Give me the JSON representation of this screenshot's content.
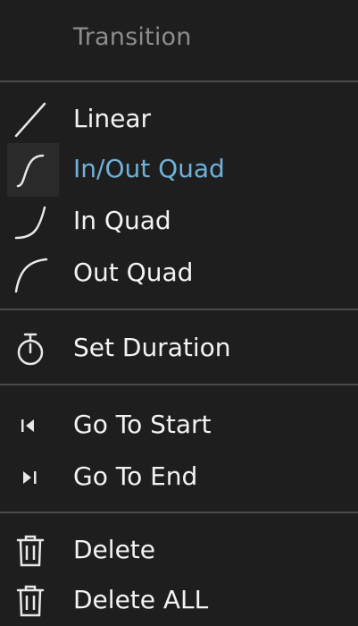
{
  "menu": {
    "header": "Transition",
    "items": [
      {
        "label": "Linear",
        "icon": "linear-curve-icon"
      },
      {
        "label": "In/Out Quad",
        "icon": "in-out-quad-curve-icon",
        "selected": true
      },
      {
        "label": "In Quad",
        "icon": "in-quad-curve-icon"
      },
      {
        "label": "Out Quad",
        "icon": "out-quad-curve-icon"
      },
      {
        "label": "Set Duration",
        "icon": "stopwatch-icon"
      },
      {
        "label": "Go To Start",
        "icon": "go-to-start-icon"
      },
      {
        "label": "Go To End",
        "icon": "go-to-end-icon"
      },
      {
        "label": "Delete",
        "icon": "trash-icon"
      },
      {
        "label": "Delete ALL",
        "icon": "trash-icon"
      }
    ]
  },
  "colors": {
    "background": "#1e1e1e",
    "header_text": "#8d8d8d",
    "text": "#f3f3f3",
    "selected_text": "#6fb2d8",
    "divider": "#4a4a4a"
  }
}
